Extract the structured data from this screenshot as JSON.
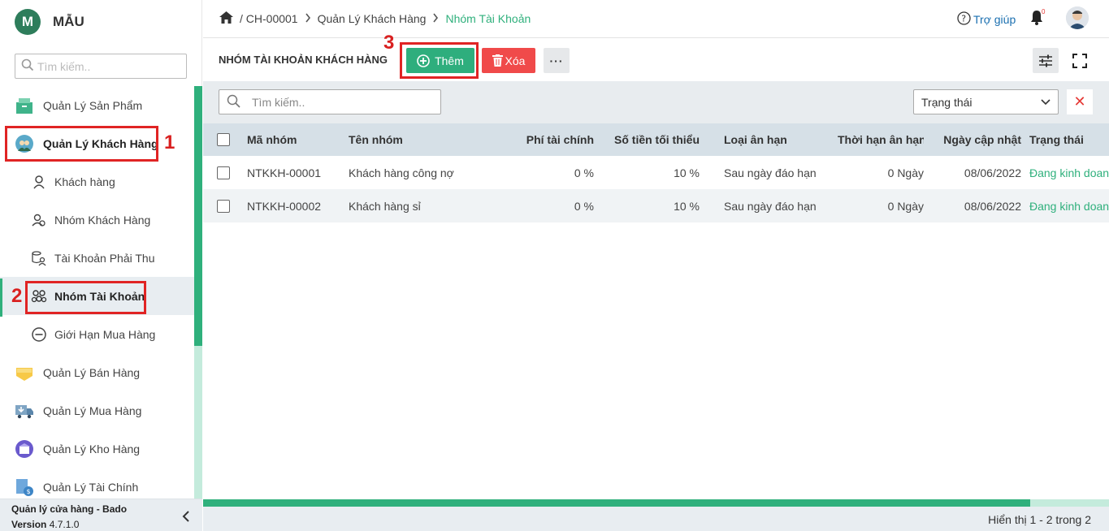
{
  "brand": {
    "logo_letter": "M",
    "name": "MẪU"
  },
  "sidebar": {
    "search_placeholder": "Tìm kiếm..",
    "items": [
      {
        "label": "Quản Lý Sản Phẩm",
        "icon": "product-box-icon"
      },
      {
        "label": "Quản Lý Khách Hàng",
        "icon": "customers-icon"
      },
      {
        "label": "Khách hàng",
        "icon": "user-icon"
      },
      {
        "label": "Nhóm Khách Hàng",
        "icon": "user-group-icon"
      },
      {
        "label": "Tài Khoản Phải Thu",
        "icon": "account-receivable-icon"
      },
      {
        "label": "Nhóm Tài Khoản",
        "icon": "account-group-icon"
      },
      {
        "label": "Giới Hạn Mua Hàng",
        "icon": "minus-circle-icon"
      },
      {
        "label": "Quản Lý Bán Hàng",
        "icon": "sale-tag-icon"
      },
      {
        "label": "Quản Lý Mua Hàng",
        "icon": "purchase-truck-icon"
      },
      {
        "label": "Quản Lý Kho Hàng",
        "icon": "warehouse-icon"
      },
      {
        "label": "Quản Lý Tài Chính",
        "icon": "finance-icon"
      }
    ],
    "footer_title": "Quản lý cửa hàng - Bado",
    "footer_version_label": "Version",
    "footer_version": "4.7.1.0"
  },
  "annotations": {
    "n1": "1",
    "n2": "2",
    "n3": "3"
  },
  "header": {
    "breadcrumb": [
      "/ CH-00001",
      "Quản Lý Khách Hàng",
      "Nhóm Tài Khoản"
    ],
    "help_label": "Trợ giúp",
    "notification_count": "0"
  },
  "toolbar": {
    "title": "NHÓM TÀI KHOẢN KHÁCH HÀNG",
    "add_label": "Thêm",
    "delete_label": "Xóa",
    "more_label": "···"
  },
  "filters": {
    "search_placeholder": "Tìm kiếm..",
    "status_label": "Trạng thái",
    "clear_label": "✕"
  },
  "table": {
    "columns": [
      "Mã nhóm",
      "Tên nhóm",
      "Phí tài chính",
      "Số tiền tối thiểu",
      "Loại ân hạn",
      "Thời hạn ân hạn",
      "Ngày cập nhật",
      "Trạng thái"
    ],
    "rows": [
      [
        "NTKKH-00001",
        "Khách hàng công nợ",
        "0 %",
        "10 %",
        "Sau ngày đáo hạn",
        "0 Ngày",
        "08/06/2022",
        "Đang kinh doanh"
      ],
      [
        "NTKKH-00002",
        "Khách hàng sỉ",
        "0 %",
        "10 %",
        "Sau ngày đáo hạn",
        "0 Ngày",
        "08/06/2022",
        "Đang kinh doanh"
      ]
    ]
  },
  "pagination": {
    "text": "Hiển thị 1 - 2 trong 2"
  },
  "colors": {
    "accent": "#2fb07c",
    "danger": "#f04a4a",
    "annotation": "#e02424"
  }
}
